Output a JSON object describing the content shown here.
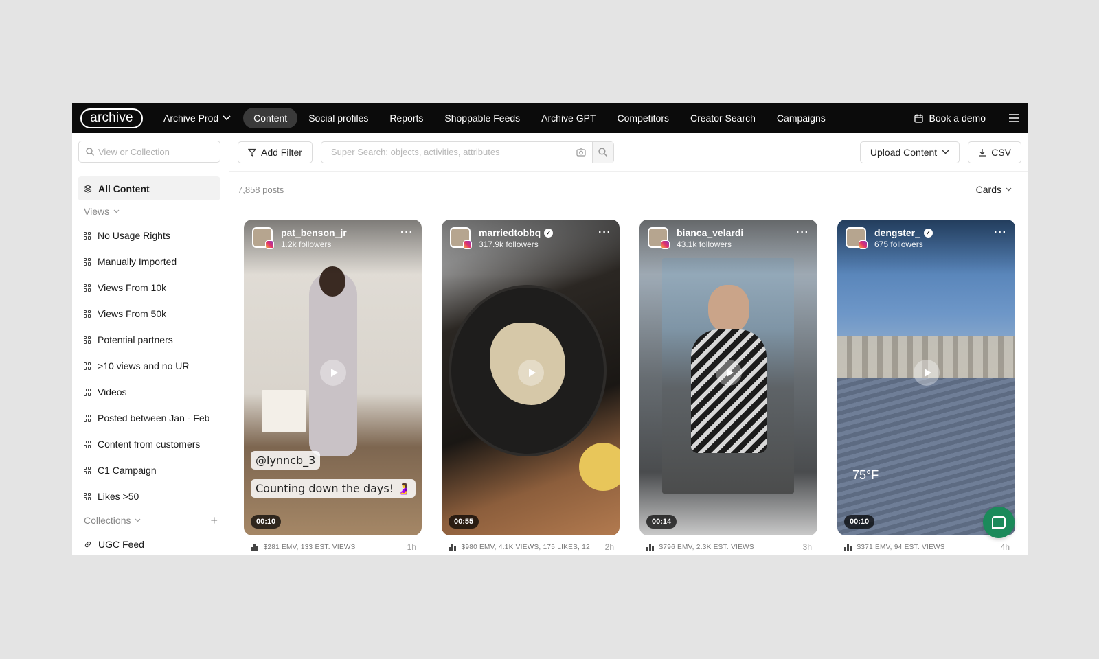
{
  "nav": {
    "logo": "archive",
    "workspace": "Archive Prod",
    "items": [
      "Content",
      "Social profiles",
      "Reports",
      "Shoppable Feeds",
      "Archive GPT",
      "Competitors",
      "Creator Search",
      "Campaigns"
    ],
    "active": "Content",
    "book_demo": "Book a demo"
  },
  "sidebar": {
    "search_placeholder": "View or Collection",
    "all_content": "All Content",
    "views_label": "Views",
    "views": [
      "No Usage Rights",
      "Manually Imported",
      "Views From 10k",
      "Views From 50k",
      "Potential partners",
      ">10 views and no UR",
      "Videos",
      "Posted between Jan - Feb",
      "Content from customers",
      "C1 Campaign",
      "Likes >50"
    ],
    "collections_label": "Collections",
    "collections": [
      "UGC Feed"
    ]
  },
  "toolbar": {
    "add_filter": "Add Filter",
    "super_search_placeholder": "Super Search: objects, activities, attributes",
    "upload": "Upload Content",
    "csv": "CSV"
  },
  "posts_count": "7,858 posts",
  "view_mode": "Cards",
  "cards": [
    {
      "username": "pat_benson_jr",
      "verified": false,
      "followers": "1.2k followers",
      "duration": "00:10",
      "meta": "$281 EMV, 133 EST. VIEWS",
      "time": "1h",
      "overlay_handle": "@lynncb_3",
      "overlay_caption": "Counting down the days! 🤰"
    },
    {
      "username": "marriedtobbq",
      "verified": true,
      "followers": "317.9k followers",
      "duration": "00:55",
      "meta": "$980 EMV, 4.1K VIEWS, 175 LIKES, 12",
      "time": "2h"
    },
    {
      "username": "bianca_velardi",
      "verified": false,
      "followers": "43.1k followers",
      "duration": "00:14",
      "meta": "$796 EMV, 2.3K EST. VIEWS",
      "time": "3h"
    },
    {
      "username": "dengster_",
      "verified": true,
      "followers": "675 followers",
      "duration": "00:10",
      "meta": "$371 EMV, 94 EST. VIEWS",
      "time": "4h",
      "overlay_temp": "75°F"
    }
  ],
  "icons": {
    "verified": "checkmark-badge-icon",
    "platform": "instagram-icon",
    "stats": "bar-chart-icon",
    "menu": "hamburger-icon",
    "chat": "chat-bubble-icon"
  },
  "colors": {
    "nav_bg": "#0b0b0b",
    "chat_button": "#1b8a5a"
  }
}
